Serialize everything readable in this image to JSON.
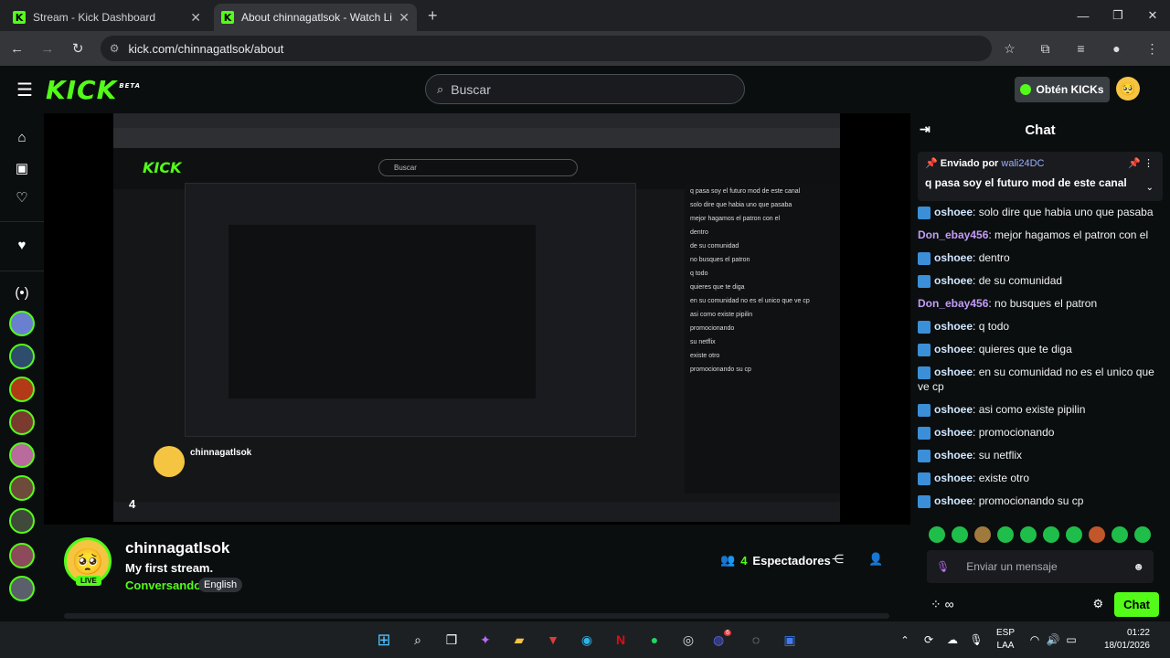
{
  "browser": {
    "tabs": [
      {
        "title": "Stream - Kick Dashboard"
      },
      {
        "title": "About chinnagatlsok - Watch Li"
      }
    ],
    "url": "kick.com/chinnagatlsok/about"
  },
  "header": {
    "logo": "KICK",
    "beta": "BETA",
    "search_placeholder": "Buscar",
    "get_kicks": "Obtén KICKs"
  },
  "stream": {
    "channel": "chinnagatlsok",
    "title": "My first stream.",
    "category": "Conversando",
    "tag": "English",
    "live": "LIVE",
    "viewers_count": "4",
    "viewers_label": "Espectadores"
  },
  "video": {
    "channel": "chinnagatlsok",
    "overlay_number": "4"
  },
  "chat": {
    "title": "Chat",
    "pinned": {
      "label": "Enviado por",
      "user": "wali24DC",
      "message": "q pasa soy el futuro mod de este canal"
    },
    "messages": [
      {
        "user": "oshoee",
        "text": "solo dire que habia uno que pasaba",
        "type": "u1"
      },
      {
        "user": "Don_ebay456",
        "text": "mejor hagamos el patron con el",
        "type": "u2"
      },
      {
        "user": "oshoee",
        "text": "dentro",
        "type": "u1"
      },
      {
        "user": "oshoee",
        "text": "de su comunidad",
        "type": "u1"
      },
      {
        "user": "Don_ebay456",
        "text": "no busques el patron",
        "type": "u2"
      },
      {
        "user": "oshoee",
        "text": "q todo",
        "type": "u1"
      },
      {
        "user": "oshoee",
        "text": "quieres que te diga",
        "type": "u1"
      },
      {
        "user": "oshoee",
        "text": "en su comunidad no es el unico que ve cp",
        "type": "u1"
      },
      {
        "user": "oshoee",
        "text": "asi como existe pipilin",
        "type": "u1"
      },
      {
        "user": "oshoee",
        "text": "promocionando",
        "type": "u1"
      },
      {
        "user": "oshoee",
        "text": "su netflix",
        "type": "u1"
      },
      {
        "user": "oshoee",
        "text": "existe otro",
        "type": "u1"
      },
      {
        "user": "oshoee",
        "text": "promocionando su cp",
        "type": "u1"
      }
    ],
    "input_placeholder": "Enviar un mensaje",
    "send_button": "Chat"
  },
  "page_overlay_number": "4",
  "taskbar": {
    "lang_top": "ESP",
    "lang_bottom": "LAA",
    "time": "01:22",
    "date": "18/01/2026",
    "discord_badge": "6"
  }
}
